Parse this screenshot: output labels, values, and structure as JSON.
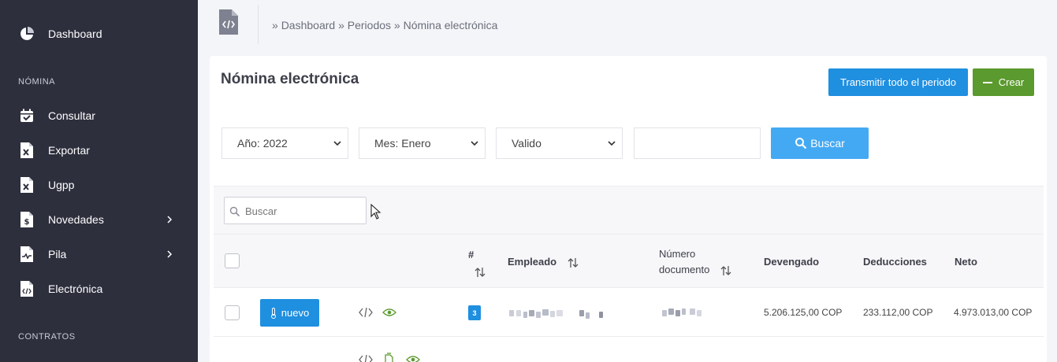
{
  "sidebar": {
    "items": [
      {
        "label": "Dashboard",
        "icon": "pie-chart-icon"
      },
      {
        "label": "Consultar",
        "icon": "calendar-check-icon"
      },
      {
        "label": "Exportar",
        "icon": "excel-file-icon"
      },
      {
        "label": "Ugpp",
        "icon": "excel-file-icon"
      },
      {
        "label": "Novedades",
        "icon": "dollar-file-icon"
      },
      {
        "label": "Pila",
        "icon": "pulse-file-icon"
      },
      {
        "label": "Electrónica",
        "icon": "code-file-icon"
      }
    ],
    "sections": [
      "NÓMINA",
      "CONTRATOS"
    ]
  },
  "breadcrumb": {
    "sep": "»",
    "items": [
      "Dashboard",
      "Periodos",
      "Nómina electrónica"
    ]
  },
  "card": {
    "title": "Nómina electrónica",
    "btn_transmit": "Transmitir todo el periodo",
    "btn_create": "Crear"
  },
  "filters": {
    "year": "Año: 2022",
    "month": "Mes: Enero",
    "status": "Valido",
    "search_btn": "Buscar"
  },
  "table": {
    "search_placeholder": "Buscar",
    "headers": {
      "num": "#",
      "employee": "Empleado",
      "doc_line1": "Número",
      "doc_line2": "documento",
      "earned": "Devengado",
      "deductions": "Deducciones",
      "net": "Neto"
    },
    "rows": [
      {
        "status_btn": "nuevo",
        "num": "3",
        "earned": "5.206.125,00 COP",
        "deductions": "233.112,00 COP",
        "net": "4.973.013,00 COP"
      }
    ]
  },
  "colors": {
    "sidebar_bg": "#2d2f3d",
    "primary": "#1f8fe0",
    "success": "#5b9a2e",
    "search": "#44a9f3"
  }
}
